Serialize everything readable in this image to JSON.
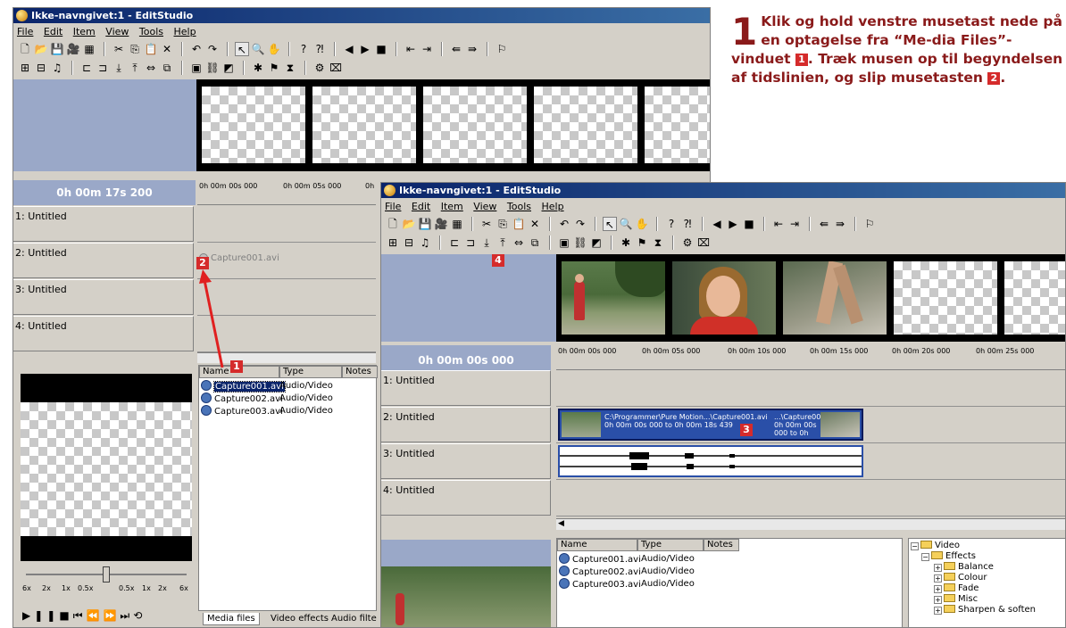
{
  "instruction": {
    "step": "1",
    "text_a": "Klik og hold venstre musetast nede på en optagelse fra “Me-dia Files”-vinduet ",
    "badge_1": "1",
    "text_b": ". Træk musen op til begyndelsen af tidslinien, og slip musetasten ",
    "badge_2": "2",
    "text_c": "."
  },
  "back_window": {
    "title": "Ikke-navngivet:1 - EditStudio",
    "menu": [
      "File",
      "Edit",
      "Item",
      "View",
      "Tools",
      "Help"
    ],
    "timecode": "0h 00m 17s 200",
    "ruler": [
      "0h 00m 00s 000",
      "0h 00m 05s 000",
      "0h"
    ],
    "tracks": [
      "1: Untitled",
      "2: Untitled",
      "3: Untitled",
      "4: Untitled"
    ],
    "drag_clip_label": "Capture001.avi",
    "media_columns": [
      "Name",
      "Type",
      "Notes"
    ],
    "media_files": [
      {
        "name": "Capture001.avi",
        "type": "Audio/Video"
      },
      {
        "name": "Capture002.avi",
        "type": "Audio/Video"
      },
      {
        "name": "Capture003.avi",
        "type": "Audio/Video"
      }
    ],
    "speed_labels": [
      "6x",
      "2x",
      "1x",
      "0.5x",
      "0.5x",
      "1x",
      "2x",
      "6x"
    ],
    "tabs": [
      "Media files",
      "Video effects",
      "Audio filte"
    ]
  },
  "front_window": {
    "title": "Ikke-navngivet:1 - EditStudio",
    "menu": [
      "File",
      "Edit",
      "Item",
      "View",
      "Tools",
      "Help"
    ],
    "timecode": "0h 00m 00s 000",
    "ruler": [
      "0h 00m 00s 000",
      "0h 00m 05s 000",
      "0h 00m 10s 000",
      "0h 00m 15s 000",
      "0h 00m 20s 000",
      "0h 00m 25s 000"
    ],
    "tracks": [
      "1: Untitled",
      "2: Untitled",
      "3: Untitled",
      "4: Untitled"
    ],
    "clip_line1": "C:\\Programmer\\Pure Motion...\\Capture001.avi",
    "clip_line2": "0h 00m 00s 000 to 0h 00m 18s 439",
    "clip2_line1": "...\\Capture00",
    "clip2_line2": "0h 00m 00s",
    "clip2_line3": "000 to 0h",
    "media_columns": [
      "Name",
      "Type",
      "Notes"
    ],
    "media_files": [
      {
        "name": "Capture001.avi",
        "type": "Audio/Video"
      },
      {
        "name": "Capture002.avi",
        "type": "Audio/Video"
      },
      {
        "name": "Capture003.avi",
        "type": "Audio/Video"
      }
    ],
    "tree": {
      "root": "Video",
      "effects": "Effects",
      "children": [
        "Balance",
        "Colour",
        "Fade",
        "Misc",
        "Sharpen & soften"
      ]
    }
  },
  "badges": {
    "b1": "1",
    "b2": "2",
    "b3": "3",
    "b4": "4"
  },
  "colors": {
    "badge": "#d52b2b",
    "instruction_text": "#8a1a1a",
    "timeline_header": "#9aa8c8",
    "clip": "#2a4fa8"
  }
}
